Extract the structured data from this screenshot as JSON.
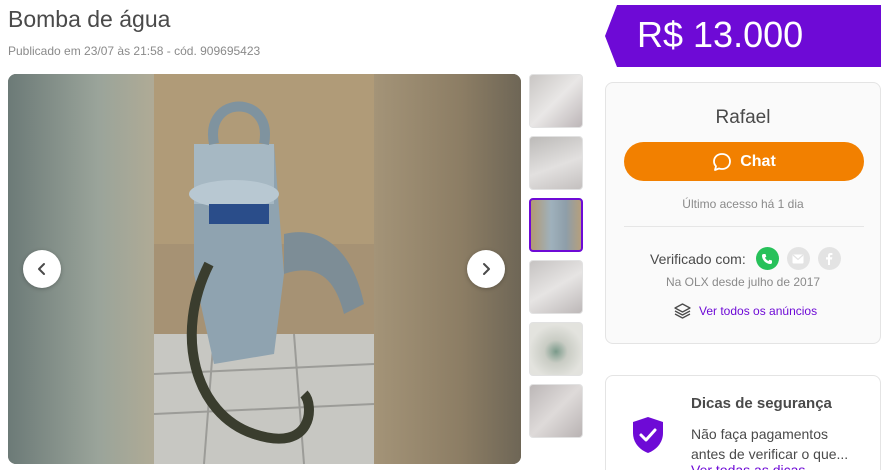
{
  "listing": {
    "title": "Bomba de água",
    "meta": "Publicado em 23/07 às 21:58 - cód. 909695423"
  },
  "price": {
    "value": "R$ 13.000",
    "tag_color": "#6e0ad6"
  },
  "gallery": {
    "thumbnail_count": 6,
    "selected_index": 2
  },
  "seller": {
    "name": "Rafael",
    "chat_label": "Chat",
    "last_access": "Último acesso há 1 dia",
    "verified_label": "Verificado com:",
    "verified_icons": [
      "phone-icon",
      "email-icon",
      "facebook-icon"
    ],
    "since": "Na OLX desde julho de 2017",
    "all_ads_label": "Ver todos os anúncios"
  },
  "safety": {
    "title": "Dicas de segurança",
    "text": "Não faça pagamentos antes de verificar o que...",
    "link": "Ver todas as dicas"
  },
  "colors": {
    "accent_purple": "#6e0ad6",
    "chat_orange": "#f28000",
    "verified_green": "#27c15a"
  }
}
